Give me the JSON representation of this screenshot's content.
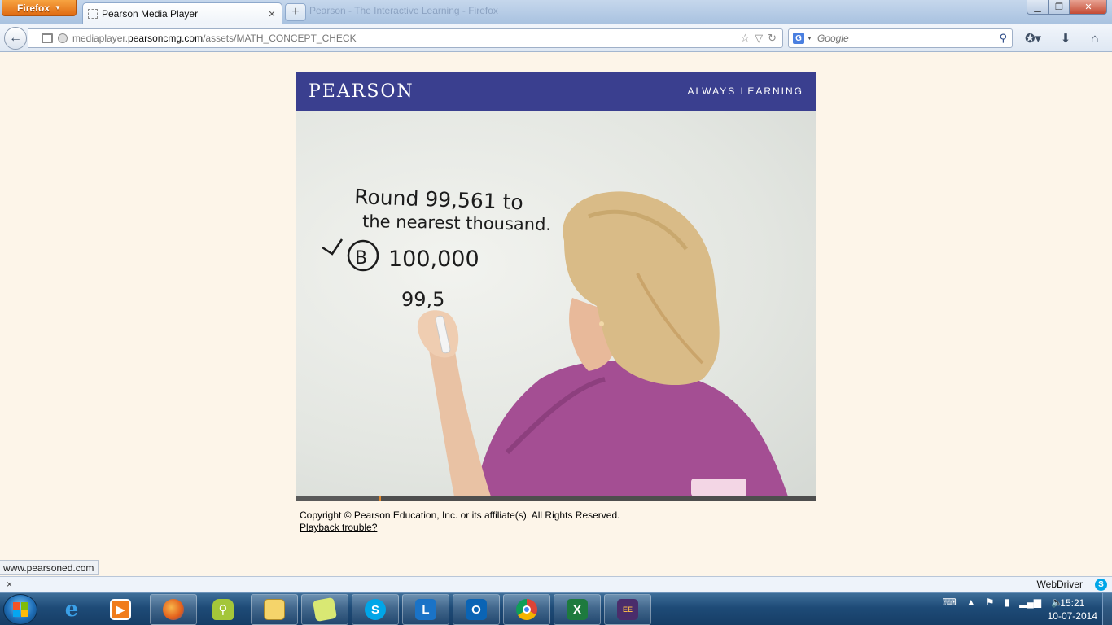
{
  "browser": {
    "menu_button": "Firefox",
    "tab_title": "Pearson Media Player",
    "blurred_window_title": "Pearson - The Interactive Learning - Firefox",
    "url_prefix": "mediaplayer.",
    "url_domain": "pearsoncmg.com",
    "url_path": "/assets/MATH_CONCEPT_CHECK",
    "search_placeholder": "Google",
    "search_engine": "G"
  },
  "player": {
    "logo": "PEARSON",
    "tagline": "ALWAYS LEARNING",
    "board_line1": "Round 99,561 to",
    "board_line2": "the nearest thousand.",
    "board_answer_letter": "B",
    "board_answer_value": "100,000",
    "board_work": "99,5",
    "progress": 0.16
  },
  "footer": {
    "copyright": "Copyright © Pearson Education, Inc. or its affiliate(s). All Rights Reserved.",
    "playback_link": "Playback trouble?"
  },
  "status": {
    "hover_url": "www.pearsoned.com"
  },
  "addon_bar": {
    "close": "×",
    "webdriver": "WebDriver"
  },
  "taskbar": {
    "items": [
      "Internet Explorer",
      "Windows Media Player",
      "Firefox",
      "Android",
      "Windows Explorer",
      "Sticky Notes",
      "Skype",
      "Lync",
      "Outlook",
      "Chrome",
      "Excel",
      "Java EE IDE"
    ],
    "time": "15:21",
    "date": "10-07-2014"
  },
  "colors": {
    "pearson_blue": "#3a3f8f",
    "page_bg": "#fdf5e9",
    "progress_marker": "#e38a2c",
    "shirt": "#a44e93"
  }
}
